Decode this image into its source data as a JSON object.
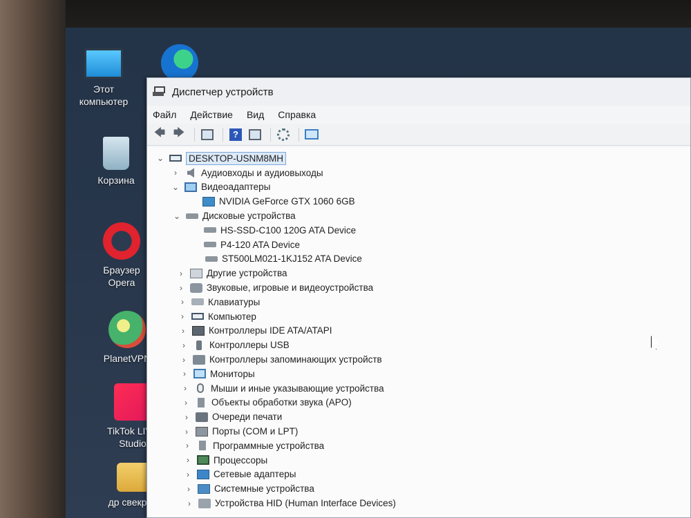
{
  "desktop": {
    "icons": [
      {
        "label": "Этот компьютер",
        "icon": "computer-icon"
      },
      {
        "label": "Корзина",
        "icon": "recycle-bin-icon"
      },
      {
        "label": "Браузер Opera",
        "icon": "opera-icon"
      },
      {
        "label": "PlanetVPN",
        "icon": "planetvpn-icon"
      },
      {
        "label": "TikTok LIVE Studio",
        "icon": "tiktok-icon"
      },
      {
        "label": "др свекрови",
        "icon": "folder-icon"
      }
    ]
  },
  "window": {
    "title": "Диспетчер устройств",
    "menu": [
      "Файл",
      "Действие",
      "Вид",
      "Справка"
    ],
    "toolbar": [
      "back-arrow-icon",
      "forward-arrow-icon",
      "properties-icon",
      "help-icon",
      "view-icon",
      "update-driver-icon",
      "scan-hardware-icon"
    ],
    "tree": {
      "root": "DESKTOP-USNM8MH",
      "items": [
        {
          "label": "Аудиовходы и аудиовыходы",
          "icon": "speaker-icon",
          "expanded": false
        },
        {
          "label": "Видеоадаптеры",
          "icon": "display-adapter-icon",
          "expanded": true,
          "children": [
            {
              "label": "NVIDIA GeForce GTX 1060 6GB",
              "icon": "gpu-icon"
            }
          ]
        },
        {
          "label": "Дисковые устройства",
          "icon": "disk-drive-icon",
          "expanded": true,
          "children": [
            {
              "label": "HS-SSD-C100 120G ATA Device",
              "icon": "disk-icon"
            },
            {
              "label": "P4-120 ATA Device",
              "icon": "disk-icon"
            },
            {
              "label": "ST500LM021-1KJ152 ATA Device",
              "icon": "disk-icon"
            }
          ]
        },
        {
          "label": "Другие устройства",
          "icon": "unknown-device-icon",
          "expanded": false
        },
        {
          "label": "Звуковые, игровые и видеоустройства",
          "icon": "sound-icon",
          "expanded": false
        },
        {
          "label": "Клавиатуры",
          "icon": "keyboard-icon",
          "expanded": false
        },
        {
          "label": "Компьютер",
          "icon": "computer-icon",
          "expanded": false
        },
        {
          "label": "Контроллеры IDE ATA/ATAPI",
          "icon": "ide-controller-icon",
          "expanded": false
        },
        {
          "label": "Контроллеры USB",
          "icon": "usb-icon",
          "expanded": false
        },
        {
          "label": "Контроллеры запоминающих устройств",
          "icon": "storage-controller-icon",
          "expanded": false
        },
        {
          "label": "Мониторы",
          "icon": "monitor-icon",
          "expanded": false
        },
        {
          "label": "Мыши и иные указывающие устройства",
          "icon": "mouse-icon",
          "expanded": false
        },
        {
          "label": "Объекты обработки звука (APO)",
          "icon": "apo-icon",
          "expanded": false
        },
        {
          "label": "Очереди печати",
          "icon": "printer-icon",
          "expanded": false
        },
        {
          "label": "Порты (COM и LPT)",
          "icon": "port-icon",
          "expanded": false
        },
        {
          "label": "Программные устройства",
          "icon": "firmware-icon",
          "expanded": false
        },
        {
          "label": "Процессоры",
          "icon": "cpu-icon",
          "expanded": false
        },
        {
          "label": "Сетевые адаптеры",
          "icon": "network-adapter-icon",
          "expanded": false
        },
        {
          "label": "Системные устройства",
          "icon": "system-device-icon",
          "expanded": false
        },
        {
          "label": "Устройства HID (Human Interface Devices)",
          "icon": "hid-icon",
          "expanded": false
        }
      ]
    }
  }
}
